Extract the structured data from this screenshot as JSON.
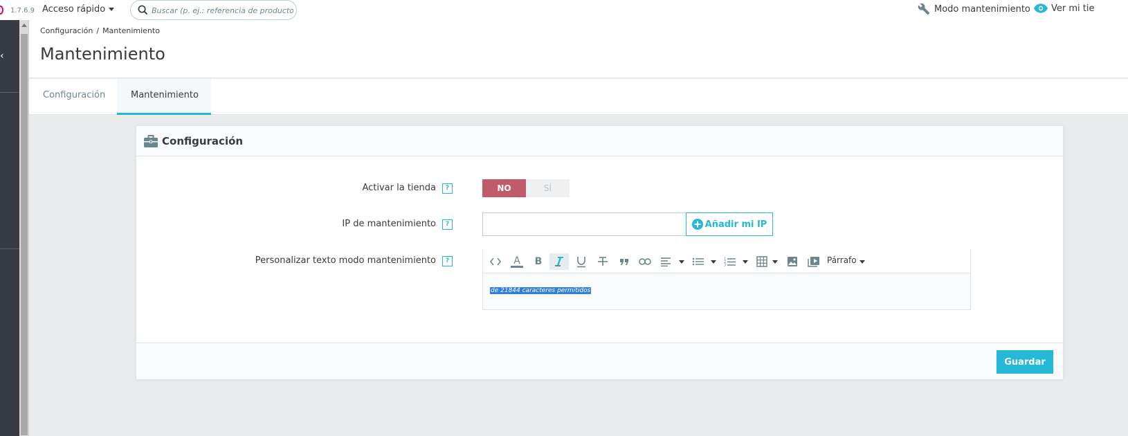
{
  "header": {
    "version": "1.7.6.9",
    "quick_access": "Acceso rápido",
    "search_placeholder": "Buscar (p. ej.: referencia de producto, nombre...",
    "maintenance_mode": "Modo mantenimiento",
    "view_store": "Ver mi tie"
  },
  "breadcrumb": {
    "parent": "Configuración",
    "separator": "/",
    "current": "Mantenimiento"
  },
  "page_title": "Mantenimiento",
  "tabs": [
    {
      "label": "Configuración",
      "active": false
    },
    {
      "label": "Mantenimiento",
      "active": true
    }
  ],
  "panel": {
    "title": "Configuración",
    "fields": {
      "enable_shop": {
        "label": "Activar la tienda",
        "no": "NO",
        "yes": "SÍ"
      },
      "maintenance_ip": {
        "label": "IP de mantenimiento",
        "value": "",
        "add_button": "Añadir mi IP"
      },
      "custom_text": {
        "label": "Personalizar texto modo mantenimiento",
        "paragraph": "Párrafo",
        "counter": "de 21844 caracteres permitidos"
      }
    },
    "help": "?",
    "save_button": "Guardar"
  },
  "colors": {
    "accent": "#25b9d7",
    "danger": "#c05c67",
    "sidebar": "#363a41"
  }
}
